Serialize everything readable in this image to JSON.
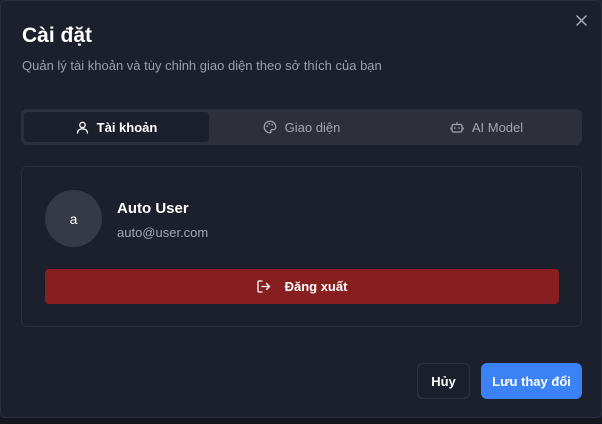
{
  "dialog": {
    "title": "Cài đặt",
    "subtitle": "Quản lý tài khoản và tùy chỉnh giao diện theo sở thích của bạn",
    "close_icon": "close-icon"
  },
  "tabs": [
    {
      "label": "Tài khoản",
      "icon": "user-icon",
      "active": true
    },
    {
      "label": "Giao diện",
      "icon": "palette-icon",
      "active": false
    },
    {
      "label": "AI Model",
      "icon": "bot-icon",
      "active": false
    }
  ],
  "account": {
    "avatar_initial": "a",
    "name": "Auto User",
    "email": "auto@user.com",
    "logout_label": "Đăng xuất",
    "logout_icon": "logout-icon"
  },
  "footer": {
    "cancel_label": "Hủy",
    "save_label": "Lưu thay đổi"
  },
  "colors": {
    "background": "#1c1f2c",
    "tab_bar": "#2d303b",
    "danger": "#871f20",
    "primary": "#3b82f6"
  }
}
